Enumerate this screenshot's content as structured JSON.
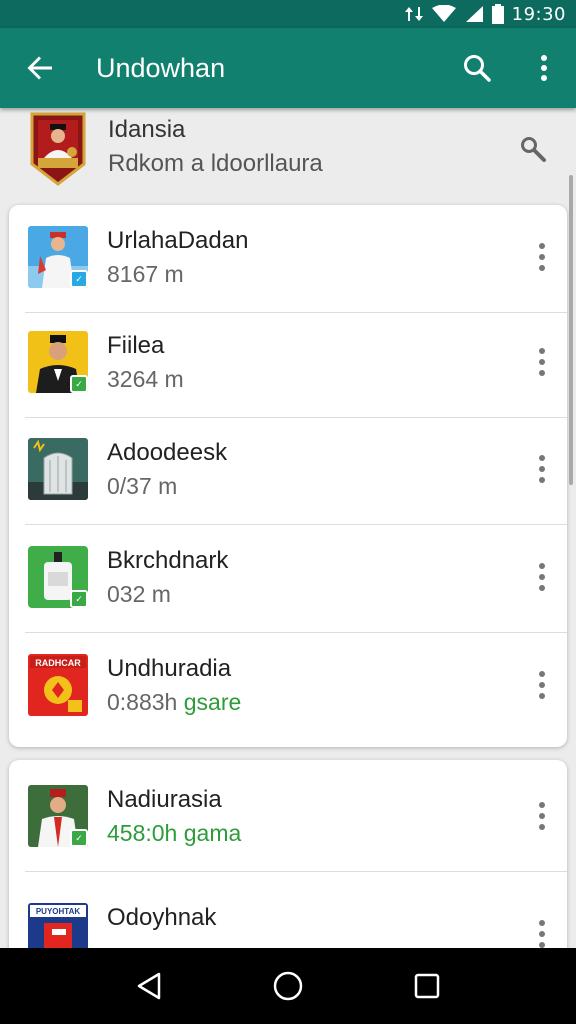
{
  "status_bar": {
    "time": "19:30"
  },
  "app_bar": {
    "title": "Undowhan"
  },
  "header": {
    "title": "Idansia",
    "subtitle": "Rdkom a ldoorllaura"
  },
  "list_primary": [
    {
      "name": "UrlahaDadan",
      "meta": "8167 m",
      "meta_extra": "",
      "badge_color": "#29a9e1"
    },
    {
      "name": "Fiilea",
      "meta": "3264 m",
      "meta_extra": "",
      "badge_color": "#3aa845"
    },
    {
      "name": "Adoodeesk",
      "meta": "0/37 m",
      "meta_extra": "",
      "badge_color": ""
    },
    {
      "name": "Bkrchdnark",
      "meta": "032 m",
      "meta_extra": "",
      "badge_color": "#3aa845"
    },
    {
      "name": "Undhuradia",
      "meta": "0:883h",
      "meta_extra": "gsare",
      "badge_color": ""
    }
  ],
  "list_secondary": [
    {
      "name": "Nadiurasia",
      "meta": "",
      "meta_extra": "458:0h gama",
      "badge_color": "#3aa845"
    },
    {
      "name": "Odoyhnak",
      "meta": "",
      "meta_extra": "",
      "badge_color": ""
    }
  ],
  "thumb_texts": {
    "item5": "RADHCAR",
    "item7": "PUYOHTAK"
  }
}
